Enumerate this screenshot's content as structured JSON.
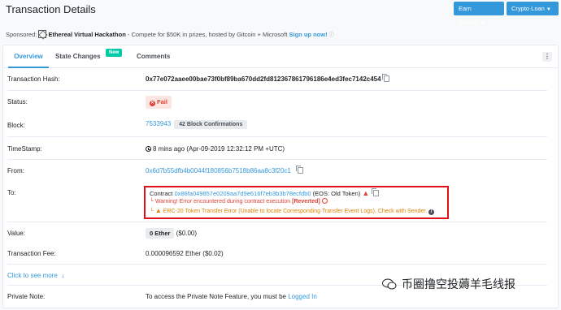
{
  "header": {
    "title": "Transaction Details",
    "earn_interest": "Earn Interest",
    "crypto_loan": "Crypto Loan"
  },
  "sponsor": {
    "label": "Sponsored:",
    "name": "Ethereal Virtual Hackathon",
    "text": " - Compete for $50K in prizes, hosted by Gitcoin + Microsoft ",
    "cta": "Sign up now!"
  },
  "tabs": {
    "overview": "Overview",
    "state_changes": "State Changes",
    "state_changes_badge": "New",
    "comments": "Comments"
  },
  "rows": {
    "hash_label": "Transaction Hash:",
    "hash_value": "0x77e072aaee00bae73f0bf89ba670dd2fd812367861796186e4ed3fec7142c454",
    "status_label": "Status:",
    "status_value": "Fail",
    "block_label": "Block:",
    "block_value": "7533943",
    "block_confirmations": "42 Block Confirmations",
    "timestamp_label": "TimeStamp:",
    "timestamp_value": "8 mins ago (Apr-09-2019 12:32:12 PM +UTC)",
    "from_label": "From:",
    "from_value": "0x6d7b55dfb4b0044f180856b7518b86aa8c3f20c1",
    "to_label": "To:",
    "to_prefix": "Contract ",
    "to_address": "0x86fa049857e0209aa7d9e616f7eb3b3b78ecfdb0",
    "to_suffix": " (EOS: Old Token)",
    "to_warning": "Warning! Error encountered during contract execution ",
    "to_reverted": "[Reverted]",
    "to_erc20": "ERC-20 Token Transfer Error (Unable to locate Corresponding Transfer Event Logs), Check with Sender.",
    "value_label": "Value:",
    "value_value": "0 Ether",
    "value_usd": "($0.00)",
    "fee_label": "Transaction Fee:",
    "fee_value": "0.000096592 Ether ($0.02)",
    "see_more": "Click to see more",
    "note_label": "Private Note:",
    "note_text": "To access the Private Note Feature, you must be ",
    "note_link": "Logged In"
  },
  "watermark": "币圈撸空投薅羊毛线报",
  "colors": {
    "accent": "#3498db",
    "fail": "#de4437",
    "highlight_border": "#e2101a",
    "warning_orange": "#e08300"
  }
}
